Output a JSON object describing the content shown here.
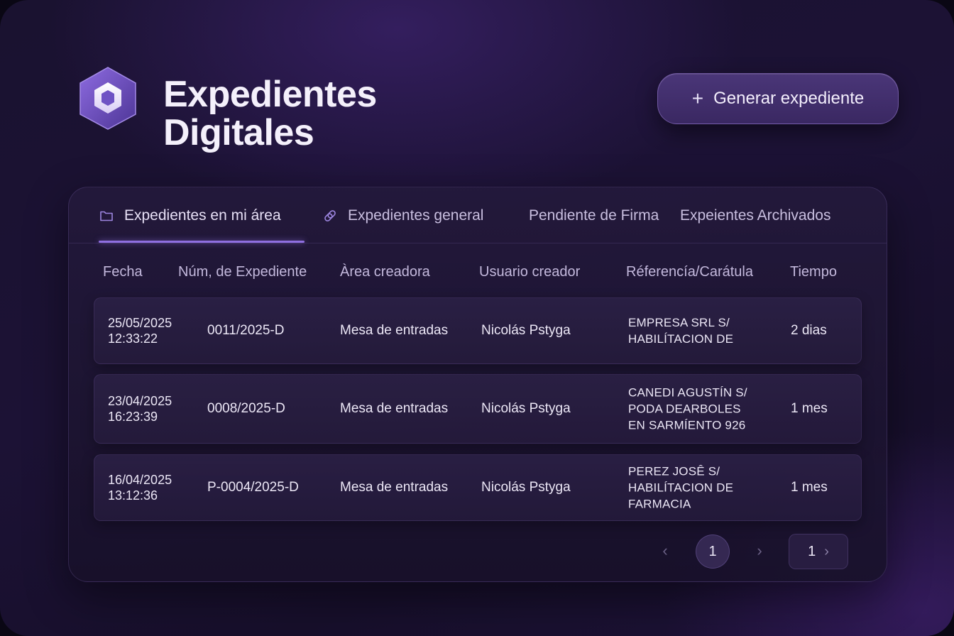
{
  "header": {
    "title_line1": "Expedientes",
    "title_line2": "Digitales",
    "generate_button_label": "Generar expediente",
    "generate_button_icon": "plus-icon"
  },
  "tabs": [
    {
      "label": "Expedientes en mi área",
      "icon": "folder-icon",
      "active": true
    },
    {
      "label": "Expedientes general",
      "icon": "link-icon",
      "active": false
    },
    {
      "label": "Pendiente de Firma",
      "active": false
    },
    {
      "label": "Expeientes Archivados",
      "active": false
    }
  ],
  "table": {
    "columns": [
      "Fecha",
      "Núm, de Expediente",
      "Àrea creadora",
      "Usuario creador",
      "Réferencía/Carátula",
      "Tiempo"
    ],
    "rows": [
      {
        "fecha": "25/05/2025",
        "hora": "12:33:22",
        "numero": "0011/2025-D",
        "area": "Mesa de entradas",
        "usuario": "Nicolás Pstyga",
        "referencia": [
          "EMPRESA SRL S/",
          "HABILÍTACION DE"
        ],
        "tiempo": "2 dias"
      },
      {
        "fecha": "23/04/2025",
        "hora": "16:23:39",
        "numero": "0008/2025-D",
        "area": "Mesa de entradas",
        "usuario": "Nicolás Pstyga",
        "referencia": [
          "CANEDI AGUSTÍN S/",
          "PODA DEARBOLES",
          "EN SARMÍENTO 926"
        ],
        "tiempo": "1 mes"
      },
      {
        "fecha": "16/04/2025",
        "hora": "13:12:36",
        "numero": "P-0004/2025-D",
        "area": "Mesa de entradas",
        "usuario": "Nicolás Pstyga",
        "referencia": [
          "PEREZ JOSÊ S/",
          "HABILÍTACION DE",
          "FARMACIA"
        ],
        "tiempo": "1 mes"
      }
    ]
  },
  "pagination": {
    "current_page": "1",
    "page_select_value": "1",
    "prev_icon": "chevron-left-icon",
    "next_icon": "chevron-right-icon"
  },
  "colors": {
    "background": "#1a1230",
    "accent": "#8f6fe0",
    "logo": "#6b4fc0"
  }
}
